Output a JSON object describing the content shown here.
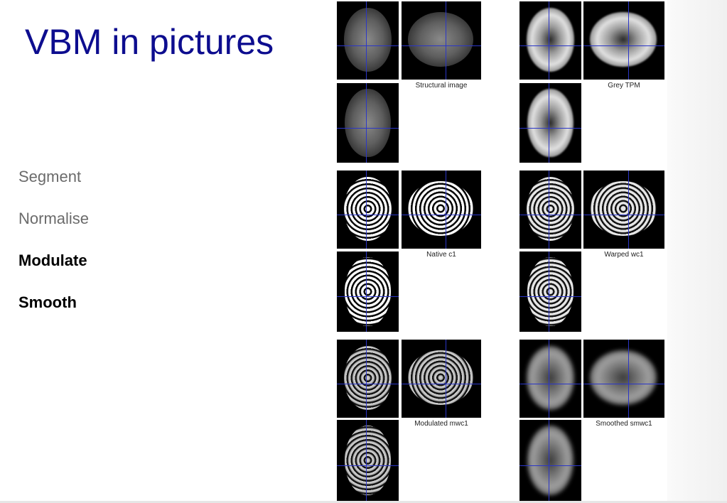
{
  "slide": {
    "title": "VBM in pictures",
    "steps": [
      {
        "label": "Segment",
        "emphasis": "dim"
      },
      {
        "label": "Normalise",
        "emphasis": "dim"
      },
      {
        "label": "Modulate",
        "emphasis": "bold"
      },
      {
        "label": "Smooth",
        "emphasis": "bold"
      }
    ]
  },
  "panels": [
    {
      "caption": "Structural image",
      "style": "structural"
    },
    {
      "caption": "Grey TPM",
      "style": "tpm"
    },
    {
      "caption": "Native c1",
      "style": "native"
    },
    {
      "caption": "Warped wc1",
      "style": "warped"
    },
    {
      "caption": "Modulated mwc1",
      "style": "modulated"
    },
    {
      "caption": "Smoothed smwc1",
      "style": "smoothed"
    }
  ],
  "colors": {
    "title": "#0d0d8f",
    "crosshair": "#2b36c8"
  }
}
